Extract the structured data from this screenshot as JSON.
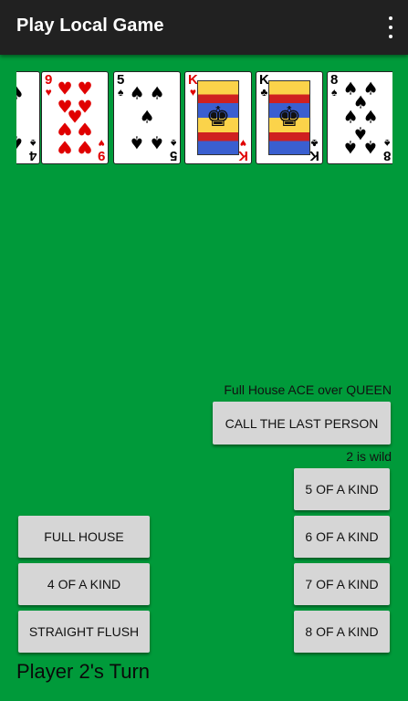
{
  "appbar": {
    "title": "Play Local Game",
    "menu_icon": "overflow-menu-icon"
  },
  "hand": [
    {
      "rank": "4",
      "suit": "♠",
      "color": "black"
    },
    {
      "rank": "9",
      "suit": "♥",
      "color": "red"
    },
    {
      "rank": "5",
      "suit": "♠",
      "color": "black"
    },
    {
      "rank": "K",
      "suit": "♥",
      "color": "red"
    },
    {
      "rank": "K",
      "suit": "♣",
      "color": "black"
    },
    {
      "rank": "8",
      "suit": "♠",
      "color": "black"
    }
  ],
  "game": {
    "last_call": "Full House ACE over QUEEN",
    "call_button": "CALL THE LAST PERSON",
    "wild_text": "2 is wild",
    "turn_text": "Player 2's Turn"
  },
  "hands_left": [
    "FULL HOUSE",
    "4 OF A KIND",
    "STRAIGHT FLUSH"
  ],
  "hands_right": [
    "5 OF A KIND",
    "6 OF A KIND",
    "7 OF A KIND",
    "8 OF A KIND"
  ],
  "colors": {
    "felt": "#009a3a",
    "appbar": "#212121",
    "button": "#d6d6d6",
    "red_suit": "#e00000"
  }
}
